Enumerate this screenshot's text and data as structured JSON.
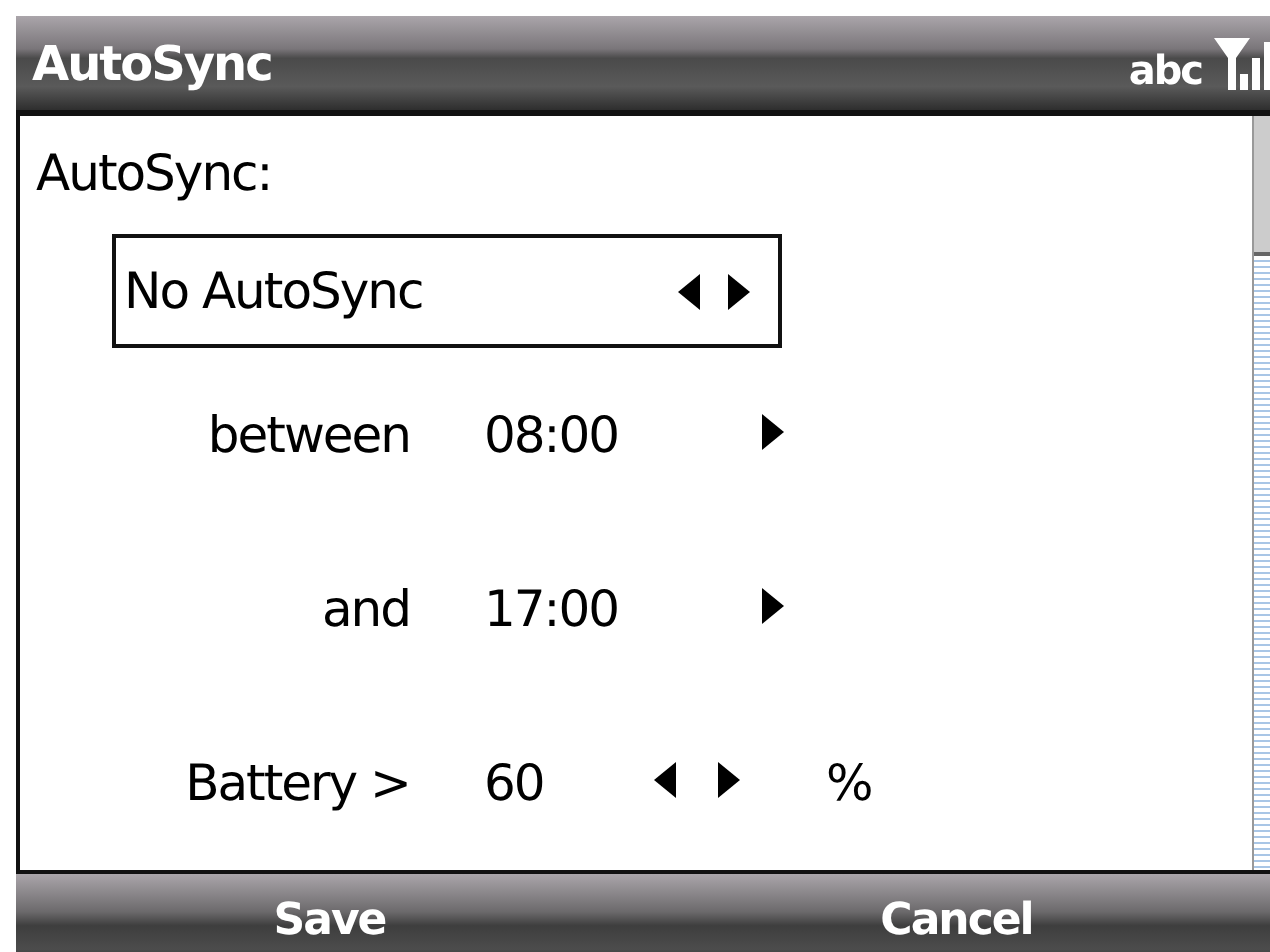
{
  "title_bar": {
    "title": "AutoSync",
    "input_mode": "abc"
  },
  "autosync_label": "AutoSync:",
  "mode_picker": {
    "value": "No AutoSync"
  },
  "rows": [
    {
      "kind": "time",
      "label": "between",
      "value": "08:00"
    },
    {
      "kind": "time",
      "label": "and",
      "value": "17:00"
    },
    {
      "kind": "spinner",
      "label": "Battery >",
      "value": "60",
      "unit": "%"
    }
  ],
  "softkeys": [
    "Save",
    "Cancel"
  ]
}
